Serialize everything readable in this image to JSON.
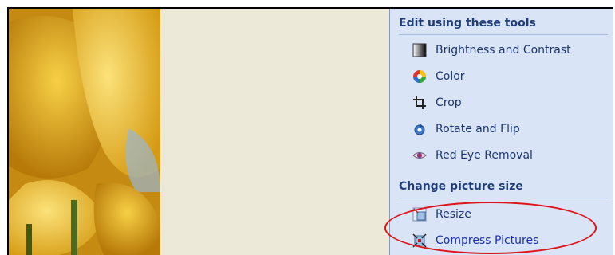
{
  "pane": {
    "sections": [
      {
        "title": "Edit using these tools",
        "items": [
          {
            "label": "Brightness and Contrast",
            "icon": "brightness-contrast-icon"
          },
          {
            "label": "Color",
            "icon": "color-wheel-icon"
          },
          {
            "label": "Crop",
            "icon": "crop-icon"
          },
          {
            "label": "Rotate and Flip",
            "icon": "rotate-flip-icon"
          },
          {
            "label": "Red Eye Removal",
            "icon": "red-eye-icon"
          }
        ]
      },
      {
        "title": "Change picture size",
        "items": [
          {
            "label": "Resize",
            "icon": "resize-icon"
          },
          {
            "label": "Compress Pictures",
            "icon": "compress-pictures-icon"
          }
        ]
      }
    ]
  },
  "colors": {
    "pane_bg": "#d9e4f6",
    "header_text": "#1f3d7a",
    "link_text": "#1c3572",
    "highlight": "#e0141b"
  }
}
